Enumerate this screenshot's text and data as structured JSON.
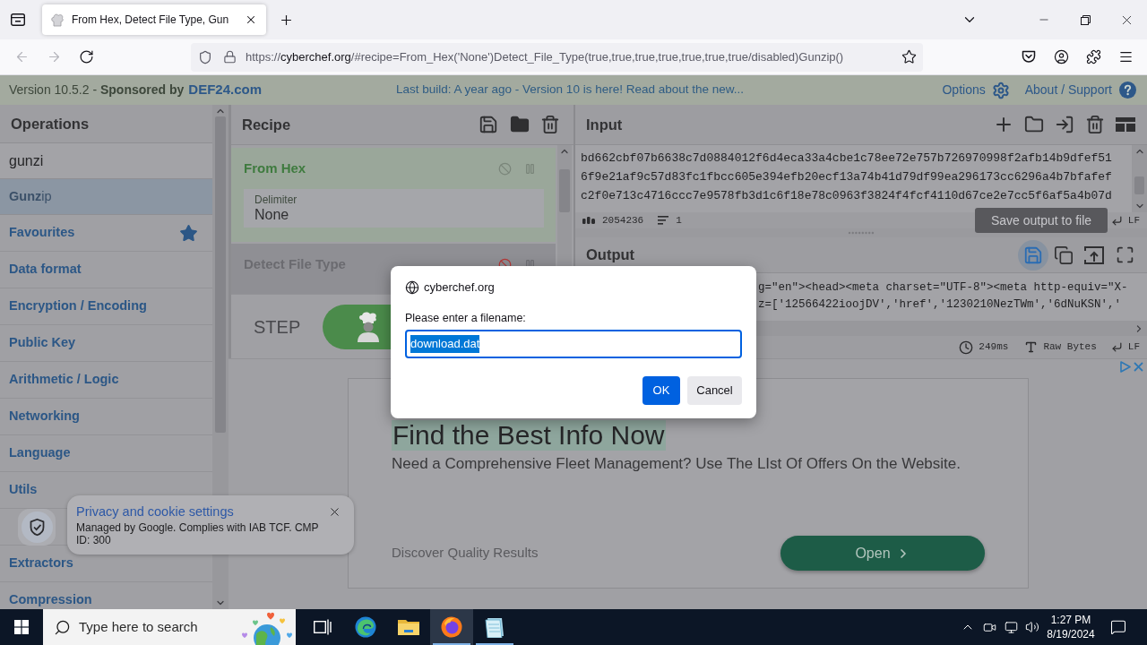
{
  "browser": {
    "tab": {
      "title": "From Hex, Detect File Type, Gun",
      "selected": true
    },
    "nav": [
      {
        "kind": "back",
        "disabled": true
      },
      {
        "kind": "forward",
        "disabled": true
      },
      {
        "kind": "reload",
        "disabled": false
      }
    ],
    "address": {
      "scheme": "https://",
      "host": "cyberchef.org",
      "path": "/#recipe=From_Hex('None')Detect_File_Type(true,true,true,true,true,true,true/disabled)Gunzip()"
    }
  },
  "banner": {
    "sponsor": "Version 10.5.2 - **Sponsored by**",
    "sponsor_link": "DEF24.com",
    "notice": "Last build: A year ago - Version 10 is here! Read about the new...",
    "options": "Options",
    "about": "About / Support"
  },
  "operations": {
    "title": "Operations",
    "search": {
      "value": "gunzi"
    },
    "results": [
      {
        "label": "**Gunz**ip",
        "selected": true
      }
    ],
    "categories": [
      {
        "kind": "favourites",
        "label": "Favourites"
      },
      {
        "kind": "category",
        "label": "Data format"
      },
      {
        "kind": "category",
        "label": "Encryption / Encoding"
      },
      {
        "kind": "category",
        "label": "Public Key"
      },
      {
        "kind": "category",
        "label": "Arithmetic / Logic"
      },
      {
        "kind": "category",
        "label": "Networking"
      },
      {
        "kind": "category",
        "label": "Language"
      },
      {
        "kind": "category",
        "label": "Utils"
      },
      {
        "kind": "covered"
      },
      {
        "kind": "category",
        "label": "Extractors"
      },
      {
        "kind": "category",
        "label": "Compression"
      }
    ]
  },
  "recipe": {
    "title": "Recipe",
    "steps": [
      {
        "name": "From Hex",
        "disabled": false,
        "args": [
          {
            "label": "Delimiter",
            "value": "None"
          }
        ]
      },
      {
        "name": "Detect File Type",
        "disabled": true
      }
    ],
    "step_button": "STEP"
  },
  "input": {
    "title": "Input",
    "lines": [
      "bd662cbf07b6638c7d0884012f6d4eca33a4cbe1c78ee72e757b726970998f2afb14b9dfef51",
      "6f9e21af9c57d83fc1fbcc605e394efb20ecf13a74b41d79df99ea296173cc6296a4b7bfafef",
      "c2f0e713c4716ccc7e9578fb3d1c6f18e78c0963f3824f4fcf4110d67ce2e7cc5f6af5a4b07d"
    ],
    "length": "2054236",
    "line_count": "1",
    "eol": "LF"
  },
  "tooltip": "Save output to file",
  "output": {
    "title": "Output",
    "tools": [
      {
        "kind": "save",
        "highlighted": true
      },
      {
        "kind": "copy",
        "highlighted": false
      },
      {
        "kind": "replace-input",
        "highlighted": false
      },
      {
        "kind": "maximise",
        "highlighted": false
      }
    ],
    "lines": [
      "g=\"en\"><head><meta charset=\"UTF-8\"><meta http-equiv=\"X-",
      "z=['12566422ioojDV','href','1230210NezTWm','6dNuKSN','"
    ],
    "time": "249ms",
    "encoding": "Raw Bytes",
    "eol": "LF"
  },
  "ad": {
    "headline": "Find the Best Info Now",
    "body": "Need a Comprehensive Fleet Management? Use The LIst Of Offers On the Website.",
    "footer": "Discover Quality Results",
    "button": "Open"
  },
  "cookie_notice": {
    "title": "Privacy and cookie settings",
    "text": "Managed by Google. Complies with IAB TCF. CMP ID: 300"
  },
  "dialog": {
    "origin": "cyberchef.org",
    "prompt": "Please enter a filename:",
    "value": "download.dat",
    "value_selected": true,
    "buttons": [
      {
        "label": "OK",
        "kind": "primary"
      },
      {
        "label": "Cancel",
        "kind": "secondary"
      }
    ]
  },
  "taskbar": {
    "search_placeholder": "Type here to search",
    "apps": [
      {
        "kind": "task-view",
        "active": false,
        "running": false
      },
      {
        "kind": "swirl-browser",
        "active": false,
        "running": false
      },
      {
        "kind": "folder",
        "active": false,
        "running": false
      },
      {
        "kind": "fox-browser",
        "active": true,
        "running": true
      },
      {
        "kind": "notebook",
        "active": false,
        "running": true
      }
    ],
    "time": "1:27 PM",
    "date": "8/19/2024"
  }
}
